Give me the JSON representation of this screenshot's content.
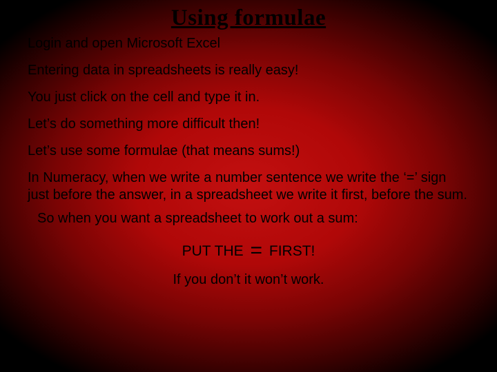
{
  "title": "Using formulae",
  "lines": {
    "l1": "Login and open Microsoft Excel",
    "l2": "Entering data in spreadsheets is really easy!",
    "l3": "You just click on the cell and type it in.",
    "l4": "Let’s do something more difficult then!",
    "l5": "Let’s use some formulae (that means sums!)",
    "l6": "In Numeracy, when we write a number sentence we write the ‘=’ sign just before the answer, in a spreadsheet we write it first, before the sum.",
    "so": "So when you want a spreadsheet to work out a sum:",
    "put_pre": "PUT THE ",
    "put_eq": "=",
    "put_post": " FIRST!",
    "foot": "If you don’t it won’t work."
  }
}
